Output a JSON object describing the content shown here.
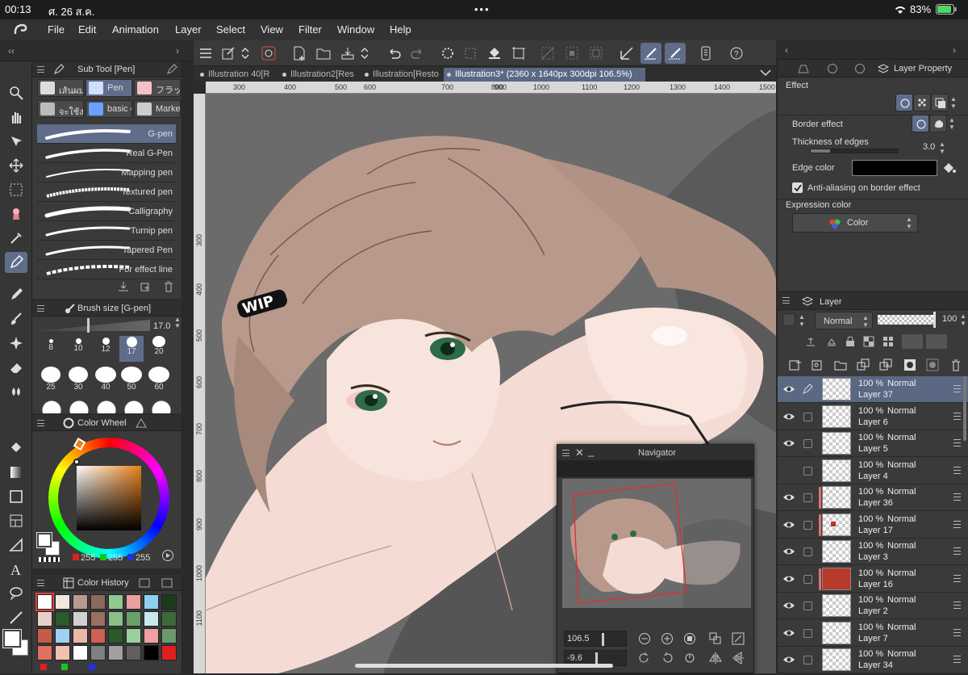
{
  "status": {
    "time": "00:13",
    "date": "ศ. 26 ส.ค.",
    "battery": "83%"
  },
  "menu": [
    "File",
    "Edit",
    "Animation",
    "Layer",
    "Select",
    "View",
    "Filter",
    "Window",
    "Help"
  ],
  "subtool": {
    "title": "Sub Tool [Pen]",
    "chips": [
      "เส้นผม",
      "Pen",
      "フラッ",
      "จะใช้ง",
      "basic c",
      "Marke"
    ],
    "brushes": [
      "G-pen",
      "Real G-Pen",
      "Mapping pen",
      "Textured pen",
      "Calligraphy",
      "Turnip pen",
      "Tapered Pen",
      "For effect line"
    ]
  },
  "brushsize": {
    "title": "Brush size [G-pen]",
    "value": "17.0",
    "sizes": [
      "8",
      "10",
      "12",
      "17",
      "20",
      "25",
      "30",
      "40",
      "50",
      "60"
    ]
  },
  "colorwheel": {
    "title": "Color Wheel",
    "r": "255",
    "g": "255",
    "b": "255"
  },
  "colorhistory": {
    "title": "Color History",
    "swatches": [
      "#ffffff",
      "#f3e6e0",
      "#b99a8e",
      "#8a6a5c",
      "#8fc98f",
      "#e8a0a0",
      "#8fd0f0",
      "#1c3a1c",
      "#e8d0c8",
      "#2c5a2c",
      "#d0d0d0",
      "#9a7060",
      "#88c088",
      "#6aa06a",
      "#c8e8f0",
      "#3a6a3a",
      "#c85a4a",
      "#a0d0f0",
      "#e8b8a8",
      "#d06050",
      "#2a5a2a",
      "#9ad09a",
      "#f0a0a0",
      "#6a9a6a",
      "#e07060",
      "#f0c0b0",
      "#ffffff",
      "#808080",
      "#a0a0a0",
      "#606060",
      "#000000",
      "#e02020"
    ]
  },
  "tabs": [
    "Illustration 40[R",
    "Illustration2[Res",
    "Illustration[Resto",
    "Illustration3* (2360 x 1640px 300dpi 106.5%)"
  ],
  "ruler": {
    "top": [
      "300",
      "400",
      "500",
      "600",
      "700",
      "800",
      "900",
      "1000",
      "1100",
      "1200",
      "1300",
      "1400",
      "1500"
    ],
    "left": [
      "300",
      "400",
      "500",
      "600",
      "700",
      "800",
      "900",
      "1000",
      "1100"
    ]
  },
  "canvas_label": "WIP",
  "navigator": {
    "title": "Navigator",
    "zoom": "106.5",
    "angle": "-9.6"
  },
  "property": {
    "title": "Layer Property",
    "effect": "Effect",
    "border_effect": "Border effect",
    "thickness_label": "Thickness of edges",
    "thickness_value": "3.0",
    "edge_color": "Edge color",
    "antialias": "Anti-aliasing on border effect",
    "expression": "Expression color",
    "expression_value": "Color"
  },
  "layer": {
    "title": "Layer",
    "blend": "Normal",
    "opacity": "100",
    "rows": [
      {
        "pct": "100 %",
        "mode": "Normal",
        "name": "Layer 37"
      },
      {
        "pct": "100 %",
        "mode": "Normal",
        "name": "Layer 6"
      },
      {
        "pct": "100 %",
        "mode": "Normal",
        "name": "Layer 5"
      },
      {
        "pct": "100 %",
        "mode": "Normal",
        "name": "Layer 4"
      },
      {
        "pct": "100 %",
        "mode": "Normal",
        "name": "Layer 36"
      },
      {
        "pct": "100 %",
        "mode": "Normal",
        "name": "Layer 17"
      },
      {
        "pct": "100 %",
        "mode": "Normal",
        "name": "Layer 3"
      },
      {
        "pct": "100 %",
        "mode": "Normal",
        "name": "Layer 16"
      },
      {
        "pct": "100 %",
        "mode": "Normal",
        "name": "Layer 2"
      },
      {
        "pct": "100 %",
        "mode": "Normal",
        "name": "Layer 7"
      },
      {
        "pct": "100 %",
        "mode": "Normal",
        "name": "Layer 34"
      }
    ]
  }
}
